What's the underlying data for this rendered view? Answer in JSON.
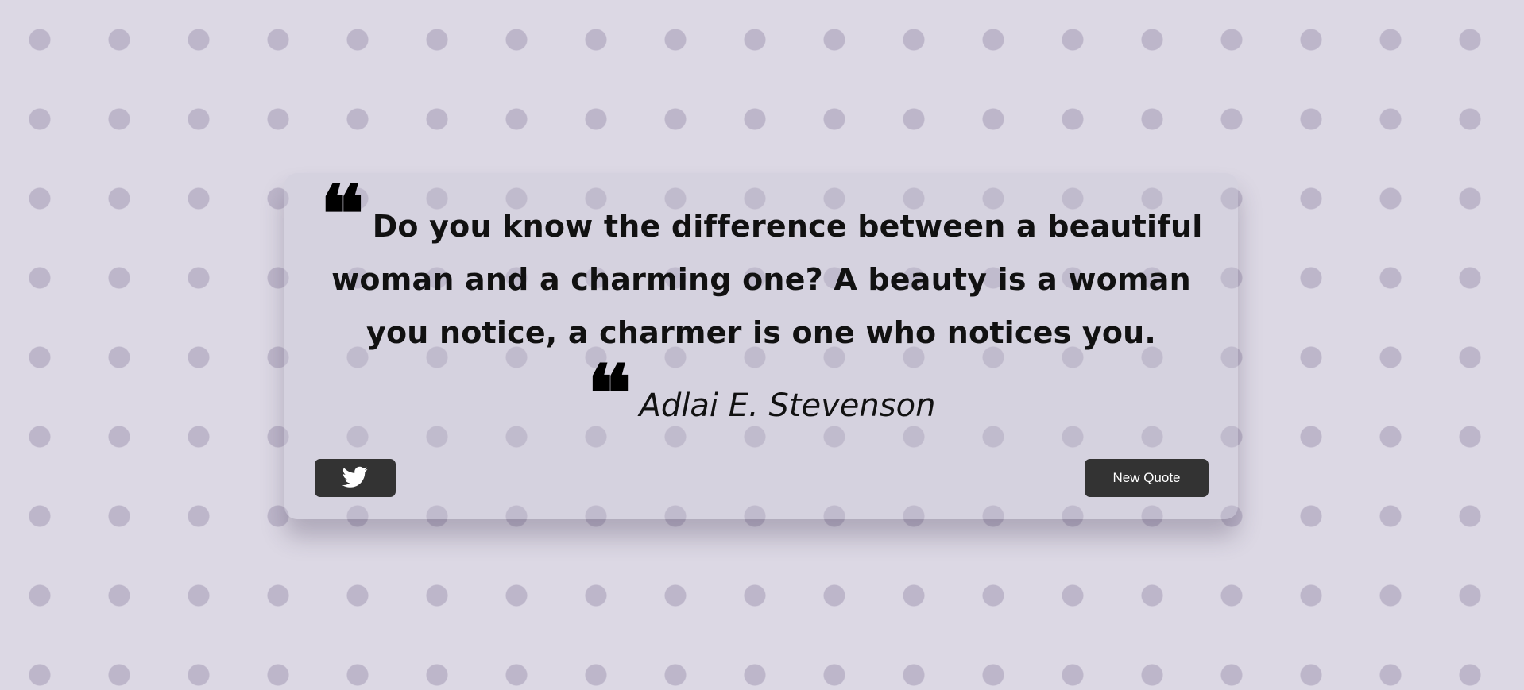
{
  "quote": {
    "text": "Do you know the difference between a beautiful woman and a charming one? A beauty is a woman you notice, a charmer is one who notices you.",
    "author": "Adlai E. Stevenson",
    "quote_glyph": "❝"
  },
  "actions": {
    "tweet_icon": "twitter-icon",
    "new_quote_label": "New Quote"
  },
  "colors": {
    "button_bg": "#333333",
    "button_text": "#ffffff",
    "text": "#111111",
    "background": "#cac5d6"
  }
}
